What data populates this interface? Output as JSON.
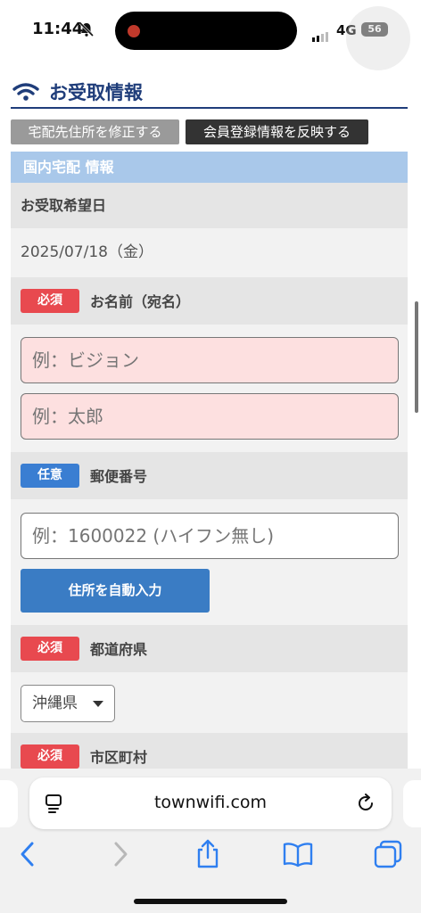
{
  "status_bar": {
    "time": "11:44",
    "network": "4G",
    "battery": "56"
  },
  "section": {
    "title": "お受取情報"
  },
  "buttons": {
    "fix_address": "宅配先住所を修正する",
    "apply_member": "会員登録情報を反映する",
    "auto_address": "住所を自動入力"
  },
  "domestic": {
    "header": "国内宅配 情報"
  },
  "fields": {
    "pickup_date_label": "お受取希望日",
    "pickup_date_value": "2025/07/18（金）",
    "name_label": "お名前（宛名）",
    "last_name_placeholder": "例：ビジョン",
    "first_name_placeholder": "例：太郎",
    "postal_label": "郵便番号",
    "postal_placeholder": "例：1600022 (ハイフン無し)",
    "prefecture_label": "都道府県",
    "prefecture_value": "沖縄県",
    "city_label": "市区町村"
  },
  "badges": {
    "required": "必須",
    "optional": "任意"
  },
  "colors": {
    "required": "#e8494f",
    "optional": "#3a7ed2",
    "title": "#1f3d7a",
    "sub_bar": "#a9c8ea",
    "auto_button": "#3a7cc4"
  },
  "browser": {
    "url": "townwifi.com"
  },
  "icons": [
    "wifi-icon",
    "bell-slash-icon",
    "reader-icon",
    "reload-icon",
    "back-icon",
    "forward-icon",
    "share-icon",
    "bookmarks-icon",
    "tabs-icon"
  ]
}
